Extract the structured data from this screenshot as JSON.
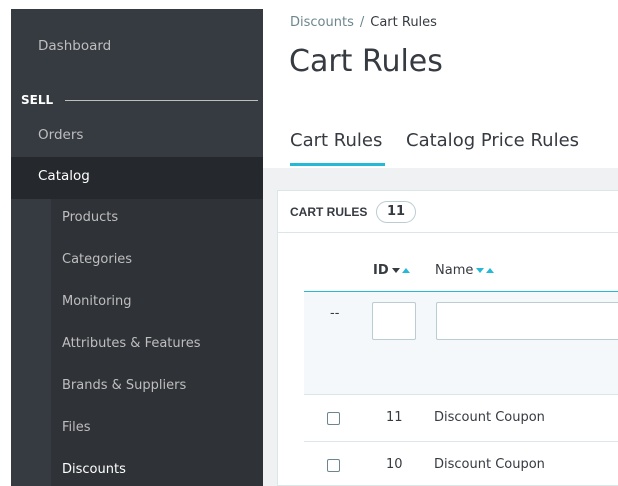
{
  "sidebar": {
    "dashboard": "Dashboard",
    "section_label": "SELL",
    "orders": "Orders",
    "catalog": "Catalog",
    "submenu": [
      "Products",
      "Categories",
      "Monitoring",
      "Attributes & Features",
      "Brands & Suppliers",
      "Files",
      "Discounts"
    ]
  },
  "header": {
    "breadcrumb_parent": "Discounts",
    "breadcrumb_sep": "/",
    "breadcrumb_current": "Cart Rules",
    "title": "Cart Rules"
  },
  "tabs": [
    "Cart Rules",
    "Catalog Price Rules"
  ],
  "panel": {
    "title": "CART RULES",
    "count": "11",
    "columns": {
      "id": "ID",
      "name": "Name"
    },
    "filter_placeholder_dash": "--",
    "rows": [
      {
        "id": "11",
        "name": "Discount Coupon"
      },
      {
        "id": "10",
        "name": "Discount Coupon"
      }
    ]
  },
  "colors": {
    "accent": "#25b9d7",
    "sidebar": "#363a41",
    "text": "#363a41"
  }
}
